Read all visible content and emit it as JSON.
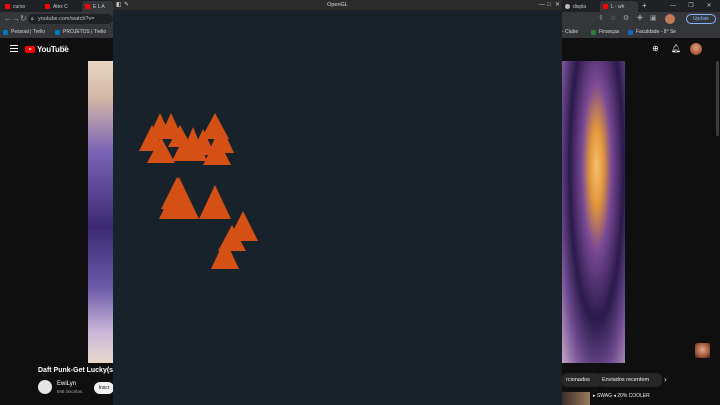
{
  "browser": {
    "tabs": [
      {
        "label": "curso",
        "color": "#ff0000"
      },
      {
        "label": "Alex C",
        "color": "#ff0000"
      },
      {
        "label": "E L A",
        "color": "#ff0000"
      }
    ],
    "right_tabs": [
      {
        "label": "displa",
        "color": "#bbbbbb"
      },
      {
        "label": "L - wh",
        "color": "#ff0000"
      }
    ],
    "new_tab_label": "+",
    "url": "youtube.com/watch?v=",
    "update_label": "Update",
    "bookmarks_left": [
      {
        "label": "Pessoal | Trello",
        "color": "#0079bf"
      },
      {
        "label": "PROJETOS | Trello",
        "color": "#0079bf"
      }
    ],
    "bookmarks_right": [
      {
        "label": "- Clube",
        "color": "#cccccc"
      },
      {
        "label": "Finanças",
        "color": "#2e7d32"
      },
      {
        "label": "Faculdade - 8° Se",
        "color": "#1565c0"
      }
    ]
  },
  "youtube": {
    "logo_text": "YouTube",
    "region": "BR",
    "video_title": "Daft Punk-Get Lucky(sp",
    "channel_name": "EwiLyn",
    "channel_subs": "846 inscritos",
    "subscribe_label": "Inscr",
    "chips": [
      "rcionados",
      "Enviados recentem"
    ],
    "chip_more": "›",
    "rec_title": "▸ SWAG ◂ 20% COOLER",
    "rec_time": "1:21"
  },
  "gl_window": {
    "title": "OpenGL",
    "background": "#18222b",
    "triangle_color": "#d45015"
  }
}
